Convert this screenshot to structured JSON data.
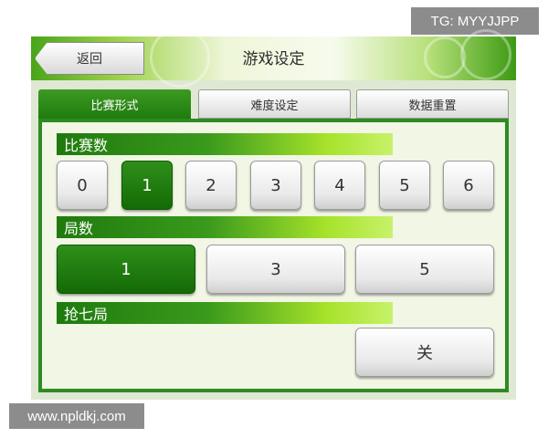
{
  "watermarks": {
    "top_right": "TG: MYYJJPP",
    "bottom_left": "www.npldkj.com"
  },
  "header": {
    "back_label": "返回",
    "title": "游戏设定"
  },
  "tabs": [
    {
      "label": "比赛形式",
      "active": true
    },
    {
      "label": "难度设定",
      "active": false
    },
    {
      "label": "数据重置",
      "active": false
    }
  ],
  "sections": {
    "matches": {
      "label": "比赛数",
      "options": [
        "0",
        "1",
        "2",
        "3",
        "4",
        "5",
        "6"
      ],
      "selected": "1"
    },
    "games": {
      "label": "局数",
      "options": [
        "1",
        "3",
        "5"
      ],
      "selected": "1"
    },
    "tiebreak": {
      "label": "抢七局",
      "value": "关"
    }
  },
  "colors": {
    "accent_dark": "#1f7a0e",
    "accent_light": "#a6e22a",
    "selected_button": "#136b06"
  }
}
